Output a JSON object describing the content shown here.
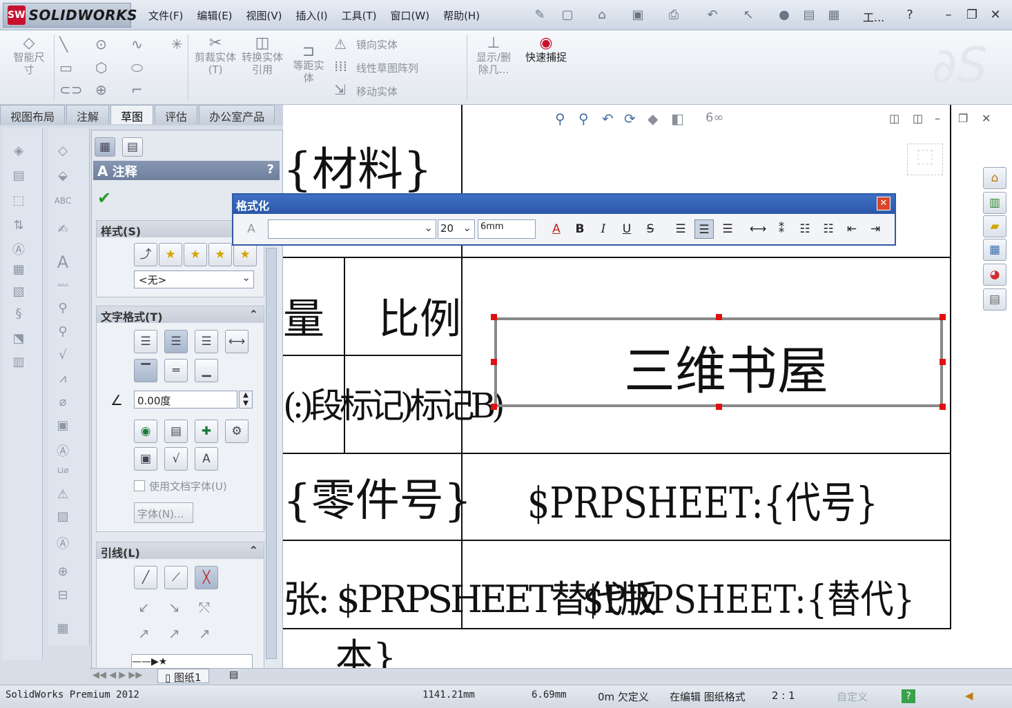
{
  "app": {
    "brand": "SOLIDWORKS",
    "brand_badge": "SW"
  },
  "menu": [
    "文件(F)",
    "编辑(E)",
    "视图(V)",
    "插入(I)",
    "工具(T)",
    "窗口(W)",
    "帮助(H)"
  ],
  "title_tools_text": "工...",
  "ribbon": {
    "smart_dim": "智能尺寸",
    "trim": "剪裁实体(T)",
    "convert": "转换实体引用",
    "offset": "等距实体",
    "mirror": "镜向实体",
    "linear_pattern": "线性草图阵列",
    "move": "移动实体",
    "show_delete": "显示/删除几...",
    "quick_snap": "快速捕捉"
  },
  "tabs": [
    "视图布局",
    "注解",
    "草图",
    "评估",
    "办公室产品"
  ],
  "active_tab": "草图",
  "property_manager": {
    "title": "注释",
    "help": "?",
    "style_group": "样式(S)",
    "style_value": "<无>",
    "text_format_group": "文字格式(T)",
    "angle_value": "0.00度",
    "use_doc_font": "使用文档字体(U)",
    "font_button": "字体(N)...",
    "leader_group": "引线(L)"
  },
  "format_toolbar": {
    "title": "格式化",
    "font_name": "",
    "font_size": "20",
    "height": "6mm"
  },
  "drawing": {
    "material": "{材料}",
    "weight": "量",
    "scale": "比例",
    "selected_note": "三维书屋",
    "overlap_text": "(:)段标记)标记B)",
    "part_number": "{零件号}",
    "code": "$PRPSHEET:{代号}",
    "row5_left": "张: $PRPSHEET替代版",
    "row5_right": "$PRPSHEET:{替代}",
    "row5_bottom": "本}"
  },
  "sheet_tab": "图纸1",
  "status": {
    "product": "SolidWorks Premium 2012",
    "x": "1141.21mm",
    "y": "6.69mm",
    "z": "0m 欠定义",
    "editing": "在编辑 图纸格式",
    "ratio": "2 : 1",
    "custom": "自定义"
  },
  "colors": {
    "accent": "#2b57a8",
    "handle": "#e01010",
    "selection": "#888888"
  }
}
